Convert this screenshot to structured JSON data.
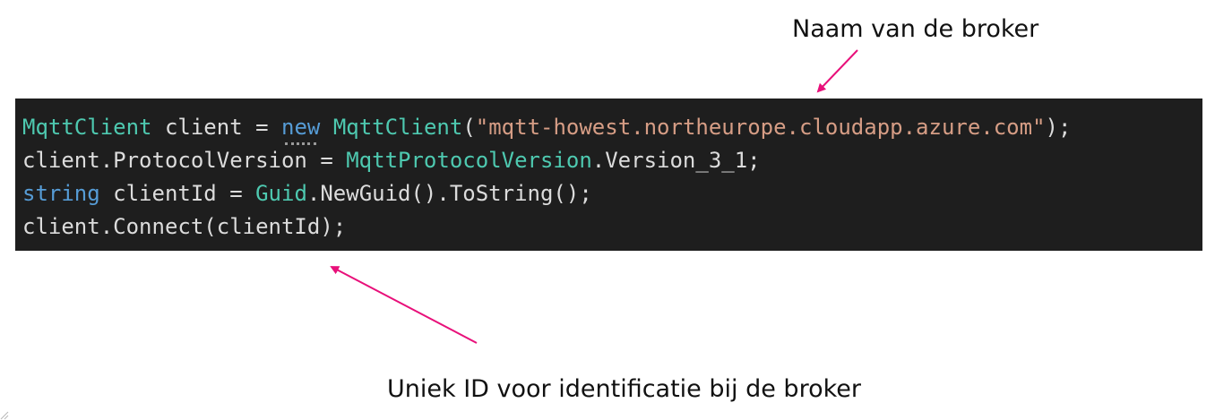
{
  "annotations": {
    "broker_name": "Naam van de broker",
    "client_id": "Uniek ID voor identificatie bij de broker"
  },
  "colors": {
    "background": "#ffffff",
    "code_background": "#1e1e1e",
    "arrow": "#e8107a",
    "type": "#4ec9b0",
    "keyword": "#569cd6",
    "string": "#d69d85",
    "plain": "#dcdcdc"
  },
  "code": {
    "line1": {
      "type": "MqttClient",
      "var": " client = ",
      "keyword": "new",
      "space": " ",
      "ctor": "MqttClient",
      "open": "(",
      "string": "\"mqtt-howest.northeurope.cloudapp.azure.com\"",
      "close": ");"
    },
    "line2": {
      "prefix": "client.ProtocolVersion = ",
      "type": "MqttProtocolVersion",
      "suffix": ".Version_3_1;"
    },
    "line3": {
      "keyword": "string",
      "middle": " clientId = ",
      "type": "Guid",
      "suffix": ".NewGuid().ToString();"
    },
    "line4": {
      "text": "client.Connect(clientId);"
    }
  },
  "icons": {
    "arrow_top": "arrow-icon",
    "arrow_bottom": "arrow-icon",
    "corner": "resize-corner-icon"
  }
}
